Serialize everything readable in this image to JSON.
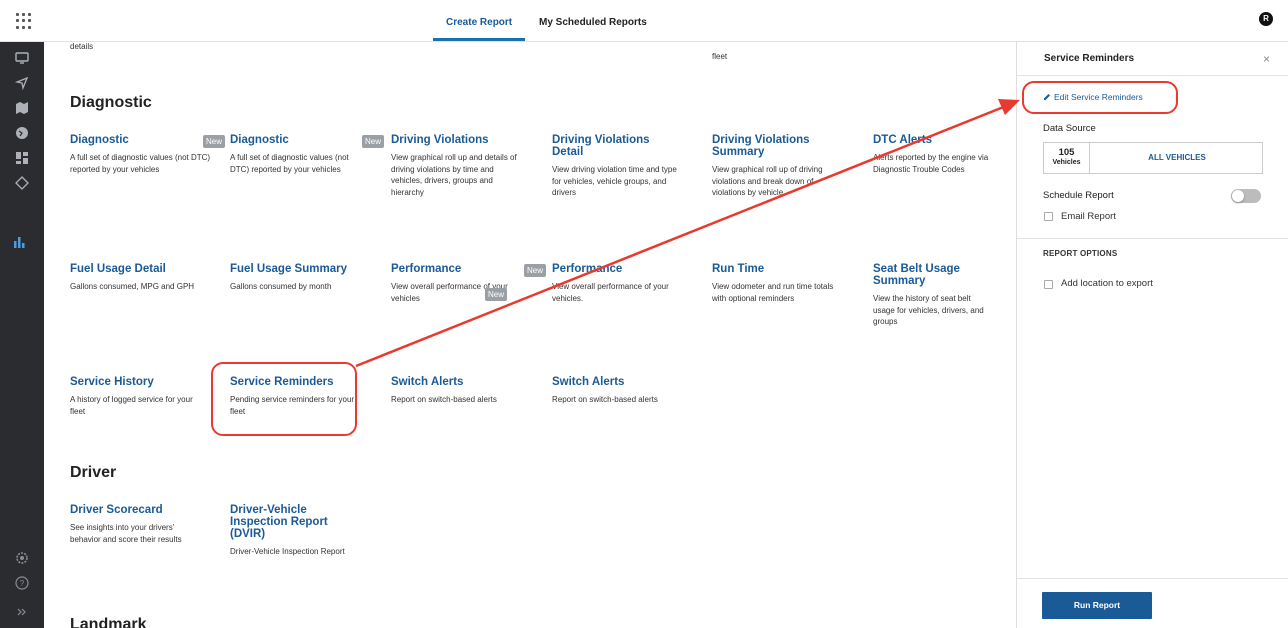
{
  "topbar": {
    "tabs": [
      {
        "label": "Create Report",
        "active": true
      },
      {
        "label": "My Scheduled Reports",
        "active": false
      }
    ],
    "avatar_initial": "R"
  },
  "leftnav": {
    "icons": [
      "monitor-icon",
      "location-arrow-icon",
      "map-icon",
      "globe-icon",
      "dashboard-icon",
      "tag-icon",
      "reports-icon",
      "settings-icon",
      "help-icon",
      "expand-icon"
    ],
    "active": "reports-icon"
  },
  "main": {
    "top_cut_texts": {
      "left": "details",
      "right": "fleet"
    },
    "sections": {
      "diagnostic": "Diagnostic",
      "driver": "Driver",
      "landmark": "Landmark"
    },
    "new_tag": "New",
    "cards": {
      "diagnostic1": {
        "title": "Diagnostic",
        "desc": "A full set of diagnostic values (not DTC) reported by your vehicles"
      },
      "diagnostic2": {
        "title": "Diagnostic",
        "desc": "A full set of diagnostic values (not DTC) reported by your vehicles"
      },
      "driving_violations": {
        "title": "Driving Violations",
        "desc": "View graphical roll up and details of driving violations by time and vehicles, drivers, groups and hierarchy"
      },
      "driving_violations_detail": {
        "title": "Driving Violations Detail",
        "desc": "View driving violation time and type for vehicles, vehicle groups, and drivers"
      },
      "driving_violations_summary": {
        "title": "Driving Violations Summary",
        "desc": "View graphical roll up of driving violations and break down of violations by vehicle"
      },
      "dtc_alerts": {
        "title": "DTC Alerts",
        "desc": "Alerts reported by the engine via Diagnostic Trouble Codes"
      },
      "fuel_usage_detail": {
        "title": "Fuel Usage Detail",
        "desc": "Gallons consumed, MPG and GPH"
      },
      "fuel_usage_summary": {
        "title": "Fuel Usage Summary",
        "desc": "Gallons consumed by month"
      },
      "performance1": {
        "title": "Performance",
        "desc": "View overall performance of your vehicles"
      },
      "performance2": {
        "title": "Performance",
        "desc": "View overall performance of your vehicles."
      },
      "run_time": {
        "title": "Run Time",
        "desc": "View odometer and run time totals with optional reminders"
      },
      "seat_belt": {
        "title": "Seat Belt Usage Summary",
        "desc": "View the history of seat belt usage for vehicles, drivers, and groups"
      },
      "service_history": {
        "title": "Service History",
        "desc": "A history of logged service for your fleet"
      },
      "service_reminders": {
        "title": "Service Reminders",
        "desc": "Pending service reminders for your fleet"
      },
      "switch_alerts1": {
        "title": "Switch Alerts",
        "desc": "Report on switch-based alerts"
      },
      "switch_alerts2": {
        "title": "Switch Alerts",
        "desc": "Report on switch-based alerts"
      },
      "driver_scorecard": {
        "title": "Driver Scorecard",
        "desc": "See insights into your drivers' behavior and score their results"
      },
      "dvir": {
        "title": "Driver-Vehicle Inspection Report (DVIR)",
        "desc": "Driver-Vehicle Inspection Report"
      }
    }
  },
  "panel": {
    "title": "Service Reminders",
    "close": "×",
    "edit_link": "Edit Service Reminders",
    "data_source_label": "Data Source",
    "vehicle_count": "105",
    "vehicle_unit": "Vehicles",
    "all_vehicles": "ALL VEHICLES",
    "schedule_label": "Schedule Report",
    "email_label": "Email Report",
    "options_title": "REPORT OPTIONS",
    "location_label": "Add location to export",
    "run_button": "Run Report"
  },
  "colors": {
    "brand_blue": "#1a5a96",
    "nav_bg": "#2a2c30",
    "annotation_red": "#e83a2e",
    "tag_grey": "#9aa0a6"
  }
}
